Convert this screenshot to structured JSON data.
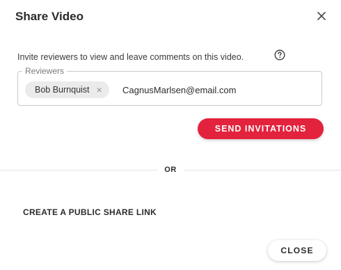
{
  "dialog": {
    "title": "Share Video",
    "close_icon": "close-icon"
  },
  "invite": {
    "description": "Invite reviewers to view and leave comments on this video.",
    "help_icon": "help-icon"
  },
  "reviewers": {
    "label": "Reviewers",
    "chips": [
      {
        "name": "Bob Burnquist",
        "remove_glyph": "×"
      }
    ],
    "input_value": "CagnusMarlsen@email.com"
  },
  "actions": {
    "send_label": "SEND INVITATIONS",
    "or_label": "OR",
    "public_link_label": "CREATE A PUBLIC SHARE LINK",
    "close_label": "CLOSE"
  },
  "colors": {
    "accent": "#e3223d",
    "text": "#2b2b2b",
    "chip_bg": "#ebebeb"
  }
}
